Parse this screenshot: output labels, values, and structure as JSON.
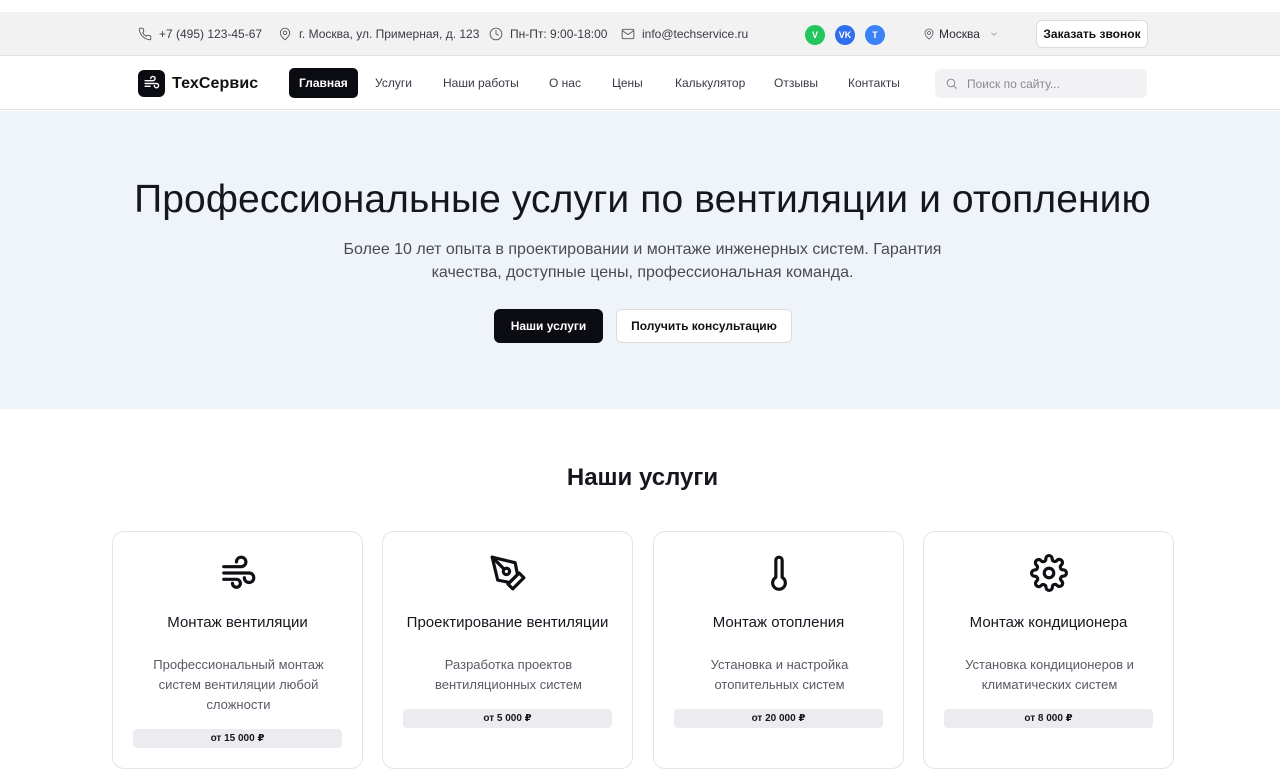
{
  "topbar": {
    "phone": "+7 (495) 123-45-67",
    "address": "г. Москва, ул. Примерная, д. 123",
    "hours": "Пн-Пт: 9:00-18:00",
    "email": "info@techservice.ru",
    "socials": [
      {
        "label": "V",
        "color": "#22c55e"
      },
      {
        "label": "VK",
        "color": "#2f6fed"
      },
      {
        "label": "T",
        "color": "#3b82f6"
      }
    ],
    "city": "Москва",
    "call_button": "Заказать звонок"
  },
  "nav": {
    "logo": "ТехСервис",
    "items": [
      "Главная",
      "Услуги",
      "Наши работы",
      "О нас",
      "Цены",
      "Калькулятор",
      "Отзывы",
      "Контакты"
    ],
    "active": "Главная",
    "search_placeholder": "Поиск по сайту..."
  },
  "hero": {
    "title": "Профессиональные услуги по вентиляции и отоплению",
    "subtitle": "Более 10 лет опыта в проектировании и монтаже инженерных систем. Гарантия качества, доступные цены, профессиональная команда.",
    "primary_button": "Наши услуги",
    "secondary_button": "Получить консультацию"
  },
  "services": {
    "title": "Наши услуги",
    "cards": [
      {
        "icon": "wind-icon",
        "title": "Монтаж вентиляции",
        "description": "Профессиональный монтаж систем вентиляции любой сложности",
        "price": "от 15 000 ₽"
      },
      {
        "icon": "pen-tool-icon",
        "title": "Проектирование вентиляции",
        "description": "Разработка проектов вентиляционных систем",
        "price": "от 5 000 ₽"
      },
      {
        "icon": "thermometer-icon",
        "title": "Монтаж отопления",
        "description": "Установка и настройка отопительных систем",
        "price": "от 20 000 ₽"
      },
      {
        "icon": "settings-icon",
        "title": "Монтаж кондиционера",
        "description": "Установка кондиционеров и климатических систем",
        "price": "от 8 000 ₽"
      }
    ]
  }
}
